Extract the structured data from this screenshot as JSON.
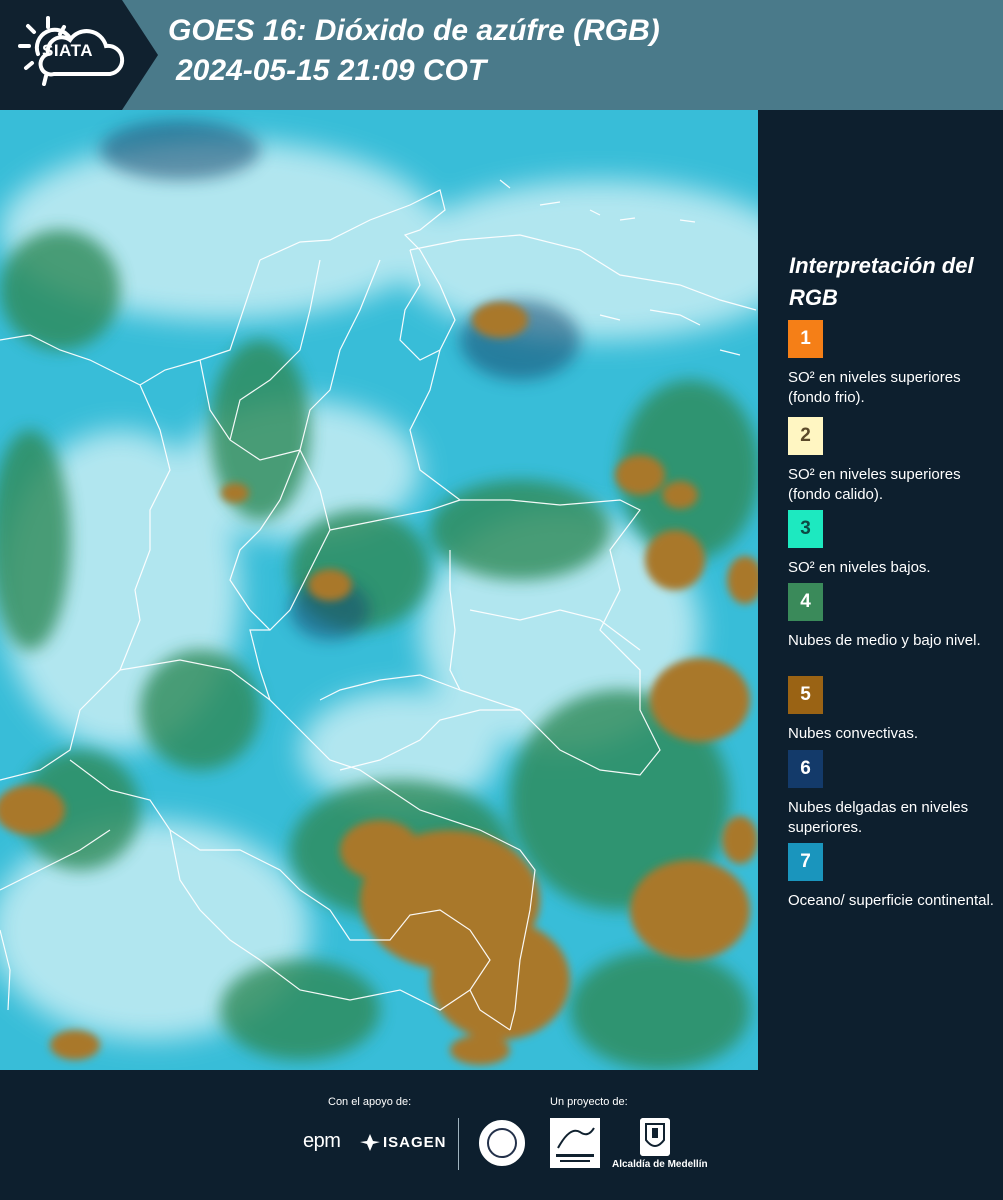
{
  "header": {
    "logo_text": "SIATA",
    "title_line1": "GOES 16: Dióxido de azúfre (RGB)",
    "title_line2": "2024-05-15 21:09 COT"
  },
  "legend": {
    "title": "Interpretación del RGB",
    "items": [
      {
        "number": "1",
        "label": "SO² en niveles superiores (fondo frio).",
        "color": "#f57f17",
        "text_color": "#ffffff"
      },
      {
        "number": "2",
        "label": "SO² en niveles superiores (fondo calido).",
        "color": "#fff6c2",
        "text_color": "#5b4a2a"
      },
      {
        "number": "3",
        "label": "SO² en niveles bajos.",
        "color": "#1de9c0",
        "text_color": "#0d4a44"
      },
      {
        "number": "4",
        "label": "Nubes de medio y bajo nivel.",
        "color": "#3a8a5a",
        "text_color": "#ffffff"
      },
      {
        "number": "5",
        "label": "Nubes convectivas.",
        "color": "#9a6314",
        "text_color": "#ffffff"
      },
      {
        "number": "6",
        "label": "Nubes delgadas en niveles superiores.",
        "color": "#133a6a",
        "text_color": "#ffffff"
      },
      {
        "number": "7",
        "label": "Oceano/ superficie continental.",
        "color": "#1a95bd",
        "text_color": "#ffffff"
      }
    ]
  },
  "footer": {
    "support_label": "Con el apoyo de:",
    "project_label": "Un proyecto de:",
    "epm": "epm",
    "isagen": "ISAGEN",
    "alcaldia": "Alcaldía de Medellín"
  },
  "colors": {
    "header_bg": "#4a7a8a",
    "panel_bg": "#0d1f2e",
    "ocean": "#3ec3dd",
    "cloud_light": "#cfeff5",
    "vegetation": "#2f8a58",
    "convective": "#a87a2a"
  }
}
